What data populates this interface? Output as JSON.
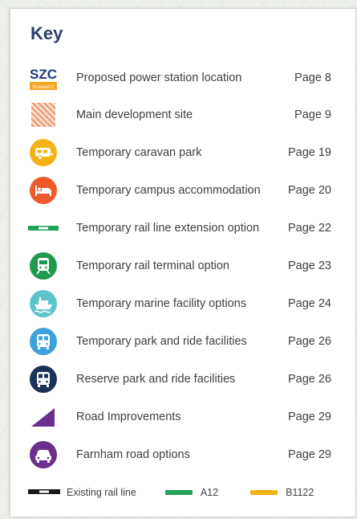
{
  "key": {
    "title": "Key",
    "items": [
      {
        "label": "Proposed power station location",
        "page": "Page 8",
        "icon": "szc-logo-icon",
        "logo_text": "SZC",
        "logo_subtext": "Sizewell C",
        "color": "#f5a623"
      },
      {
        "label": "Main development site",
        "page": "Page 9",
        "icon": "hatched-area-icon",
        "color": "#f0a07a"
      },
      {
        "label": "Temporary caravan park",
        "page": "Page 19",
        "icon": "caravan-icon",
        "color": "#f5b214"
      },
      {
        "label": "Temporary campus accommodation",
        "page": "Page 20",
        "icon": "bed-icon",
        "color": "#ef5a2c"
      },
      {
        "label": "Temporary rail line extension option",
        "page": "Page 22",
        "icon": "rail-extension-line-icon",
        "color": "#1fa35a"
      },
      {
        "label": "Temporary rail terminal option",
        "page": "Page 23",
        "icon": "train-icon",
        "color": "#1f9a4e"
      },
      {
        "label": "Temporary marine facility options",
        "page": "Page 24",
        "icon": "ship-icon",
        "color": "#5ec4c8"
      },
      {
        "label": "Temporary park and ride facilities",
        "page": "Page 26",
        "icon": "bus-icon",
        "color": "#3da1db"
      },
      {
        "label": "Reserve park and ride facilities",
        "page": "Page 26",
        "icon": "bus-dark-icon",
        "color": "#1b3358"
      },
      {
        "label": "Road Improvements",
        "page": "Page 29",
        "icon": "triangle-icon",
        "color": "#6b2f8e"
      },
      {
        "label": "Farnham road options",
        "page": "Page 29",
        "icon": "car-icon",
        "color": "#6b2f8e"
      }
    ],
    "bottom": [
      {
        "label": "Existing rail line",
        "icon": "existing-rail-line-icon",
        "color": "#1a1a1a"
      },
      {
        "label": "A12",
        "icon": "a12-road-line-icon",
        "color": "#21a35a"
      },
      {
        "label": "B1122",
        "icon": "b1122-road-line-icon",
        "color": "#f5b214"
      }
    ]
  }
}
